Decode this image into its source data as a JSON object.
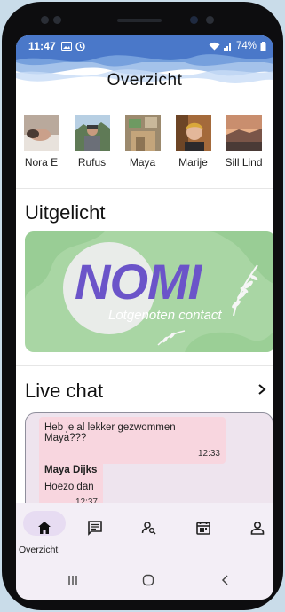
{
  "status": {
    "time": "11:47",
    "battery": "74%",
    "icons": [
      "gallery-icon",
      "alarm-icon",
      "wifi-icon",
      "signal-icon",
      "battery-icon"
    ]
  },
  "header": {
    "title": "Overzicht"
  },
  "contacts": [
    {
      "name": "Nora E"
    },
    {
      "name": "Rufus"
    },
    {
      "name": "Maya"
    },
    {
      "name": "Marije"
    },
    {
      "name": "Sill Lind"
    }
  ],
  "featured": {
    "title": "Uitgelicht",
    "banner_logo": "NOMI",
    "banner_subtitle": "Lotgenoten contact"
  },
  "live_chat": {
    "title": "Live chat",
    "messages": [
      {
        "text": "Heb je al lekker gezwommen Maya???",
        "time": "12:33"
      },
      {
        "sender": "Maya Dijks",
        "text": "Hoezo dan",
        "time": "12:37"
      }
    ]
  },
  "nav": {
    "items": [
      {
        "id": "overzicht",
        "label": "Overzicht",
        "icon": "home-icon",
        "active": true
      },
      {
        "id": "chat",
        "label": "",
        "icon": "chat-icon",
        "active": false
      },
      {
        "id": "search-people",
        "label": "",
        "icon": "person-search-icon",
        "active": false
      },
      {
        "id": "calendar",
        "label": "",
        "icon": "calendar-icon",
        "active": false
      },
      {
        "id": "profile",
        "label": "",
        "icon": "profile-icon",
        "active": false
      }
    ]
  },
  "colors": {
    "status_bar": "#3d6fc2",
    "accent_green": "#a9d6a4",
    "logo_purple": "#6b54c9",
    "chat_bg": "#eee4ee",
    "bubble": "#f8d6df",
    "nav_bg": "#f3eef6",
    "nav_active": "#e7dcf2"
  }
}
